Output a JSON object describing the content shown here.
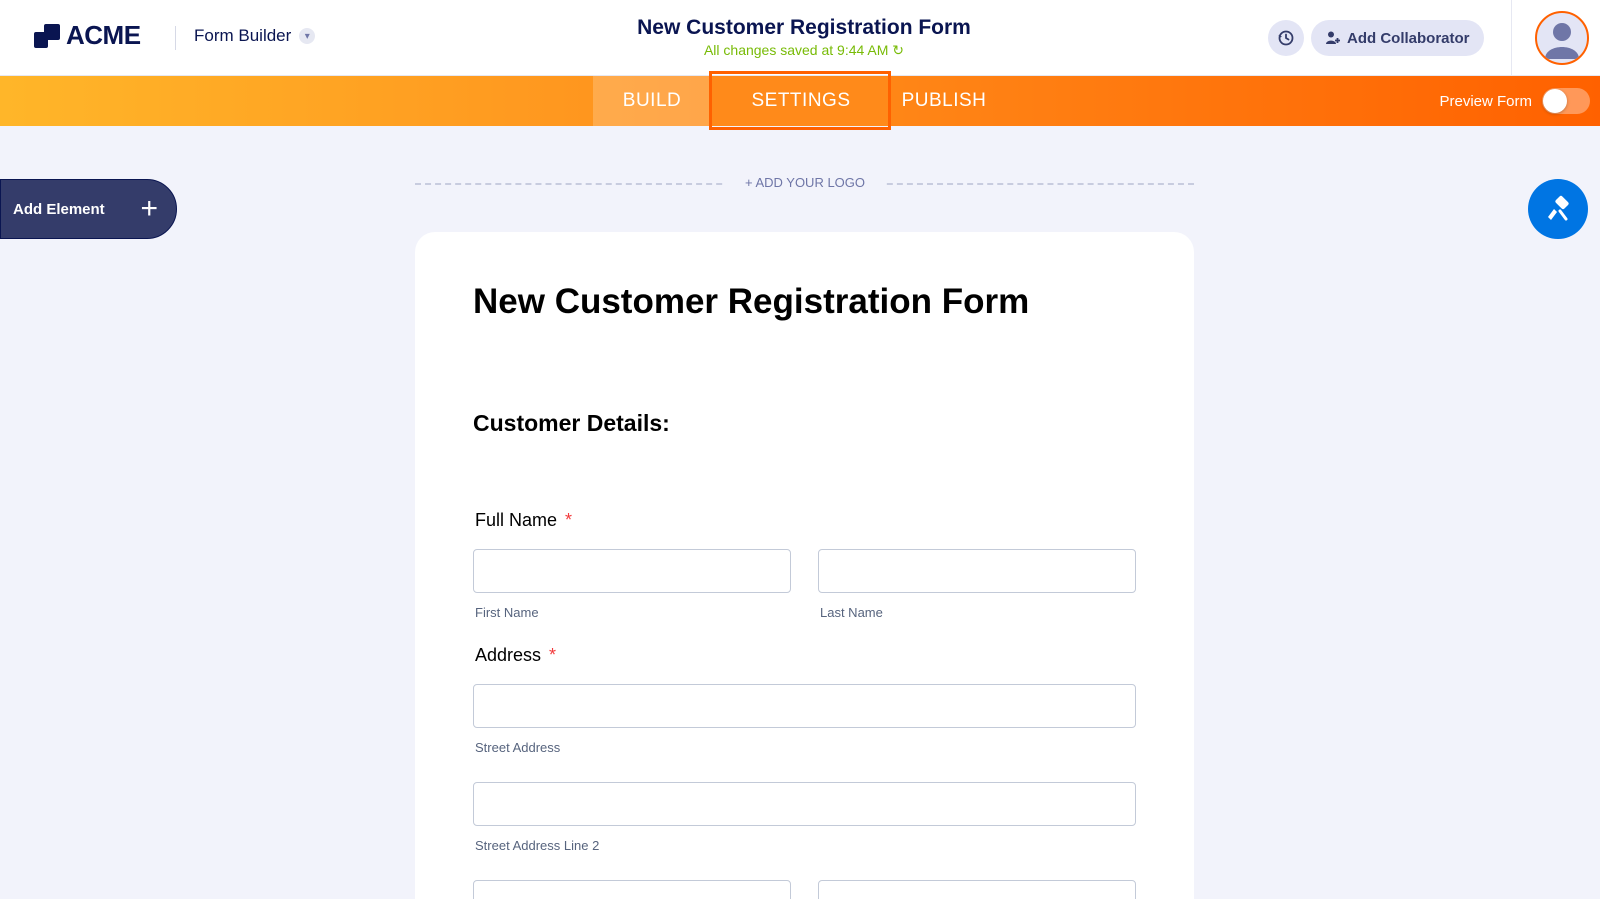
{
  "header": {
    "logo_text": "ACME",
    "app_name": "Form Builder",
    "form_title": "New Customer Registration Form",
    "save_status": "All changes saved at 9:44 AM",
    "add_collaborator_label": "Add Collaborator"
  },
  "nav": {
    "tabs": [
      {
        "label": "BUILD"
      },
      {
        "label": "SETTINGS",
        "selected": true
      },
      {
        "label": "PUBLISH"
      }
    ],
    "preview_label": "Preview Form",
    "preview_on": false
  },
  "sidebar": {
    "add_element_label": "Add Element"
  },
  "canvas": {
    "add_logo_label": "+ ADD YOUR LOGO"
  },
  "form": {
    "heading": "New Customer Registration Form",
    "section_heading": "Customer Details:",
    "full_name": {
      "label": "Full Name",
      "required_mark": "*",
      "first_sublabel": "First Name",
      "last_sublabel": "Last Name"
    },
    "address": {
      "label": "Address",
      "required_mark": "*",
      "street_sublabel": "Street Address",
      "street2_sublabel": "Street Address Line 2"
    }
  },
  "colors": {
    "accent_orange": "#ff6100",
    "nav_gradient_start": "#ffb629",
    "save_green": "#78bb07",
    "design_blue": "#0075e3",
    "navy": "#0a1551"
  },
  "icons": {
    "history": "history-icon",
    "collaborator": "add-user-icon",
    "avatar": "user-avatar-icon",
    "design": "paint-roller-icon",
    "add": "plus-icon",
    "chevron": "chevron-down-icon",
    "refresh": "refresh-icon"
  }
}
